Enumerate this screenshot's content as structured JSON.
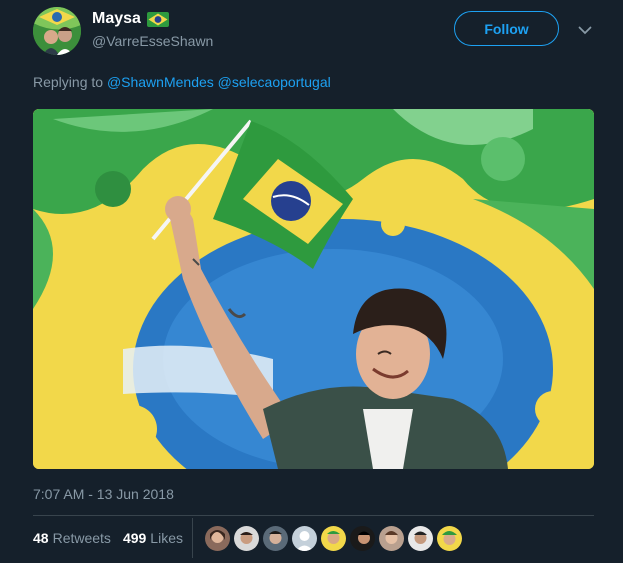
{
  "user": {
    "display_name": "Maysa",
    "name_flag": "brazil-flag-emoji",
    "handle": "@VarreEsseShawn"
  },
  "actions": {
    "follow_label": "Follow",
    "menu_icon": "chevron-down-icon"
  },
  "reply": {
    "prefix": "Replying to",
    "mentions": [
      "@ShawnMendes",
      "@selecaoportugal"
    ]
  },
  "media": {
    "description_icon": "photo-shawn-brazil-flag"
  },
  "timestamp": "7:07 AM - 13 Jun 2018",
  "stats": {
    "retweets_count": "48",
    "retweets_label": "Retweets",
    "likes_count": "499",
    "likes_label": "Likes"
  },
  "likers_count": 9,
  "colors": {
    "background": "#15202b",
    "accent": "#1da1f2",
    "secondary_text": "#8899a6",
    "divider": "#38444d",
    "brazil_green": "#2e9a3e",
    "brazil_yellow": "#f2d84a",
    "brazil_blue": "#2a78c4"
  }
}
